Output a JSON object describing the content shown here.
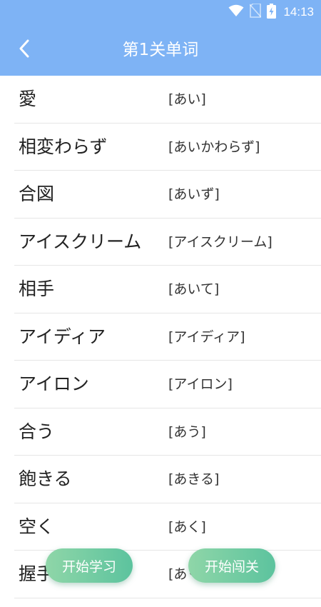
{
  "colors": {
    "header_bg": "#7eb3f5",
    "button_gradient_start": "#8fd6a8",
    "button_gradient_end": "#5cc39e",
    "divider": "#e6e6e6"
  },
  "status_bar": {
    "time": "14:13",
    "icons": [
      "wifi-icon",
      "no-sim-icon",
      "battery-charging-icon"
    ]
  },
  "header": {
    "title": "第1关单词",
    "back_icon": "chevron-left-icon"
  },
  "words": [
    {
      "word": "愛",
      "reading": "[あい]"
    },
    {
      "word": "相変わらず",
      "reading": "[あいかわらず]"
    },
    {
      "word": "合図",
      "reading": "[あいず]"
    },
    {
      "word": "アイスクリーム",
      "reading": "[アイスクリーム]"
    },
    {
      "word": "相手",
      "reading": "[あいて]"
    },
    {
      "word": "アイディア",
      "reading": "[アイディア]"
    },
    {
      "word": "アイロン",
      "reading": "[アイロン]"
    },
    {
      "word": "合う",
      "reading": "[あう]"
    },
    {
      "word": "飽きる",
      "reading": "[あきる]"
    },
    {
      "word": "空く",
      "reading": "[あく]"
    },
    {
      "word": "握手",
      "reading": "[あくしゅ]"
    }
  ],
  "actions": {
    "start_study": "开始学习",
    "start_challenge": "开始闯关"
  }
}
